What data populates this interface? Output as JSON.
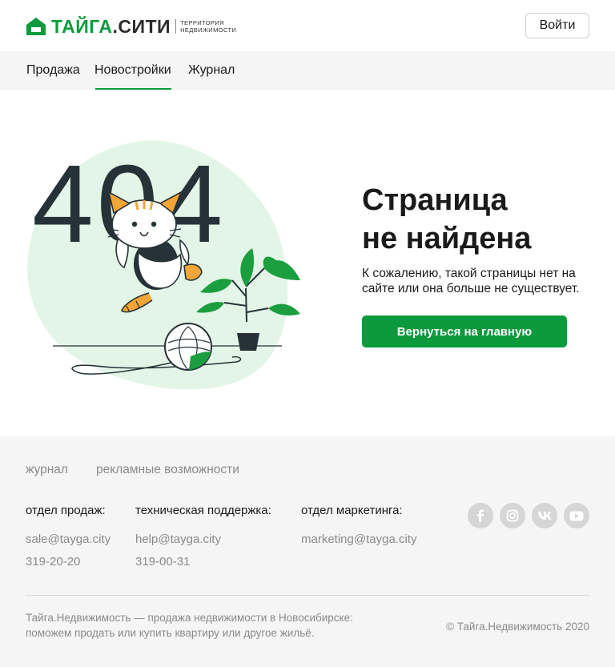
{
  "header": {
    "logo_brand": "ТАЙГА",
    "logo_city": ".СИТИ",
    "logo_tagline_1": "ТЕРРИТОРИЯ",
    "logo_tagline_2": "НЕДВИЖИМОСТИ",
    "login_label": "Войти"
  },
  "nav": {
    "items": [
      {
        "label": "Продажа"
      },
      {
        "label": "Новостройки",
        "active": true
      },
      {
        "label": "Журнал"
      }
    ]
  },
  "main": {
    "error_code": "404",
    "title_line_1": "Страница",
    "title_line_2": "не найдена",
    "subtitle": "К сожалению, такой страницы нет на сайте или она больше не существует.",
    "home_button_label": "Вернуться на главную"
  },
  "footer": {
    "links": [
      "журнал",
      "рекламные возможности"
    ],
    "contacts": [
      {
        "heading": "отдел продаж:",
        "email": "sale@tayga.city",
        "phone": "319-20-20"
      },
      {
        "heading": "техническая поддержка:",
        "email": "help@tayga.city",
        "phone": "319-00-31"
      },
      {
        "heading": "отдел маркетинга:",
        "email": "marketing@tayga.city"
      }
    ],
    "socials": [
      "facebook-icon",
      "instagram-icon",
      "vk-icon",
      "youtube-icon"
    ],
    "about_line_1": "Тайга.Недвижимость — продажа недвижимости в Новосибирске:",
    "about_line_2": "поможем продать или купить квартиру или другое жильё.",
    "copyright": "© Тайга.Недвижимость 2020"
  },
  "colors": {
    "brand_green": "#0a9a3d",
    "footer_bg": "#f5f5f5",
    "blob_green": "#e3f5e6",
    "dark_text": "#1a1a1a",
    "muted_text": "#8a8a8a"
  }
}
